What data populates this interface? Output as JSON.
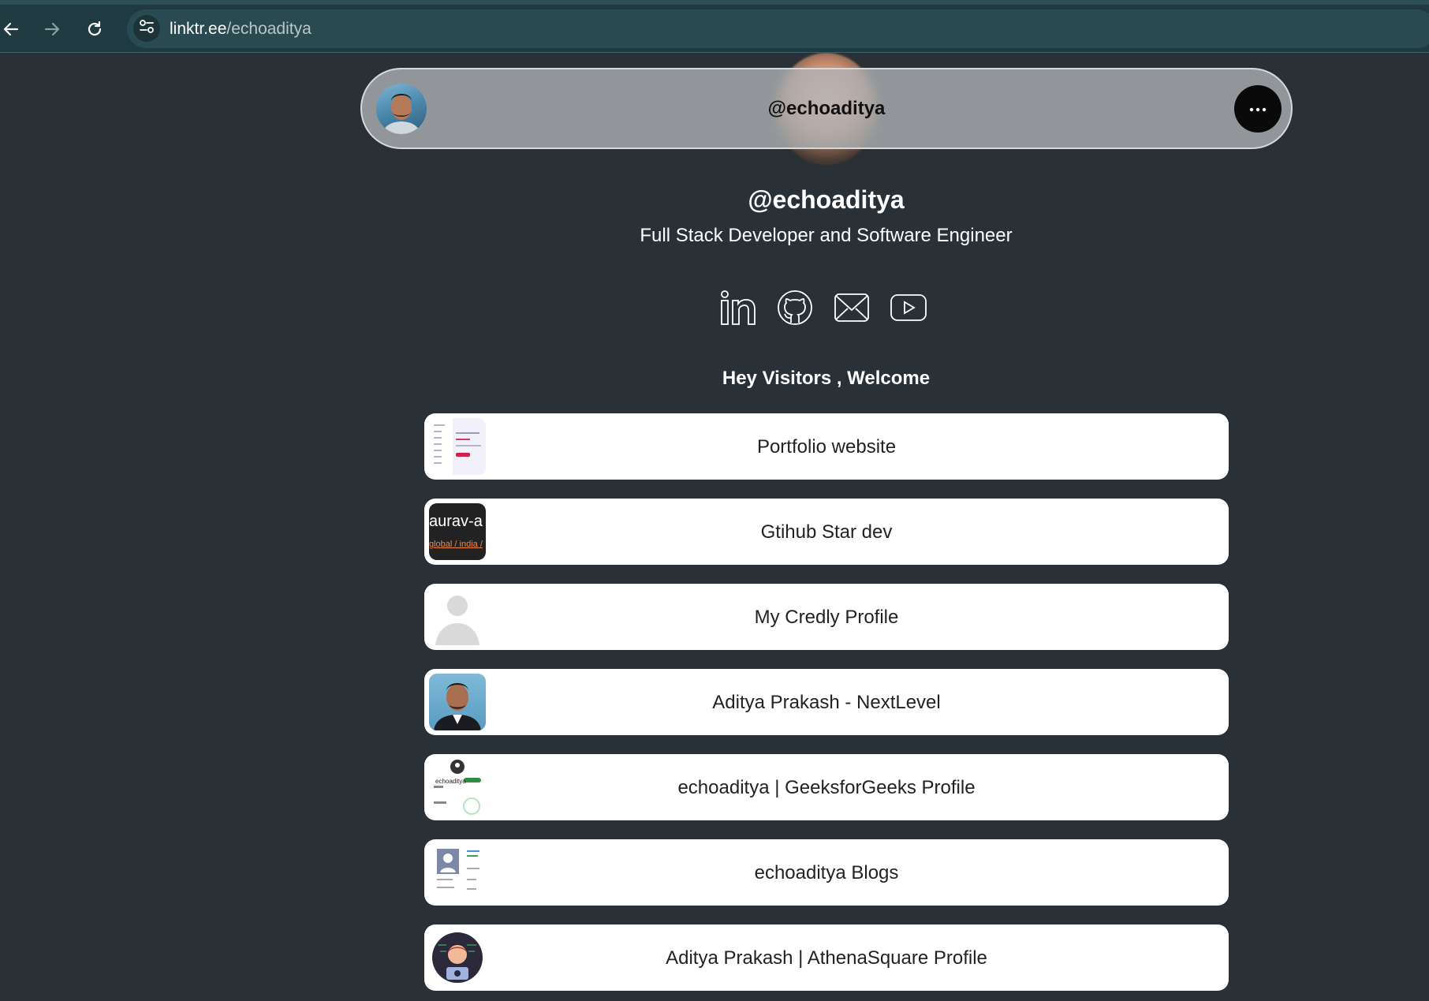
{
  "browser": {
    "url_host": "linktr.ee",
    "url_path": "/echoaditya"
  },
  "header": {
    "title": "@echoaditya"
  },
  "profile": {
    "name": "@echoaditya",
    "bio": "Full Stack Developer and Software Engineer"
  },
  "social_icons": [
    "linkedin-icon",
    "github-icon",
    "email-icon",
    "youtube-icon"
  ],
  "welcome": "Hey Visitors , Welcome",
  "links": [
    {
      "label": "Portfolio website"
    },
    {
      "label": "Gtihub Star dev",
      "thumb_text": "aurav-a",
      "thumb_subtext": "global / india /"
    },
    {
      "label": "My Credly Profile"
    },
    {
      "label": "Aditya Prakash - NextLevel"
    },
    {
      "label": "echoaditya | GeeksforGeeks Profile",
      "thumb_text": "echoaditya"
    },
    {
      "label": "echoaditya Blogs"
    },
    {
      "label": "Aditya Prakash | AthenaSquare Profile"
    }
  ],
  "colors": {
    "background": "#2a3136",
    "card": "#ffffff",
    "header_pill": "#aeb3b5"
  }
}
